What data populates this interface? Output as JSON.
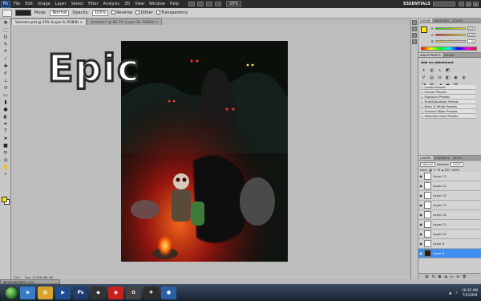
{
  "appbar": {
    "logo": "Ps",
    "menu": [
      "File",
      "Edit",
      "Image",
      "Layer",
      "Select",
      "Filter",
      "Analysis",
      "3D",
      "View",
      "Window",
      "Help"
    ],
    "zoom": "25%",
    "workspace": "ESSENTIALS"
  },
  "options": {
    "mode_label": "Mode:",
    "mode_value": "Normal",
    "opacity_label": "Opacity:",
    "opacity_value": "100%",
    "reverse": "Reverse",
    "dither": "Dither",
    "transparency": "Transparency"
  },
  "tabs": [
    {
      "label": "Veenoon.psd @ 25% (Layer 8, RGB/8) ×",
      "active": true
    },
    {
      "label": "Untitled-1 @ 66.7% (Layer 10, RGB/8) ×",
      "active": false
    }
  ],
  "canvas": {
    "overlay_text": "Epic"
  },
  "status": {
    "zoom": "25%",
    "doc": "Doc: 20.0M/186.3M"
  },
  "measurement_log": "MEASUREMENT LOG",
  "color_panel": {
    "tabs": [
      "COLOR",
      "SWATCHES",
      "STYLES"
    ],
    "r": "226",
    "g": "203",
    "b": "0"
  },
  "adjustments": {
    "tabs": [
      "ADJUSTMENTS",
      "MASKS"
    ],
    "title": "Add an adjustment",
    "presets": [
      "Levels Presets",
      "Curves Presets",
      "Exposure Presets",
      "Hue/Saturation Presets",
      "Black & White Presets",
      "Channel Mixer Presets",
      "Selective Color Presets"
    ]
  },
  "layers_panel": {
    "tabs": [
      "LAYERS",
      "CHANNELS",
      "PATHS"
    ],
    "blend_mode": "Normal",
    "opacity_label": "Opacity:",
    "opacity_value": "100%",
    "lock_label": "Lock:",
    "fill_label": "Fill:",
    "fill_value": "100%",
    "layers": [
      "Layer 11",
      "Layer 12",
      "Layer 15",
      "Layer 13",
      "Layer 14",
      "Layer 11",
      "Layer 10",
      "Layer 9",
      "Layer 8"
    ],
    "selected_layer": "Layer 8"
  },
  "taskbar": {
    "time": "10:35 AM",
    "date": "7/5/2009"
  },
  "colors": {
    "foreground": "#ffe600",
    "selected_layer": "#3f8ef0"
  }
}
